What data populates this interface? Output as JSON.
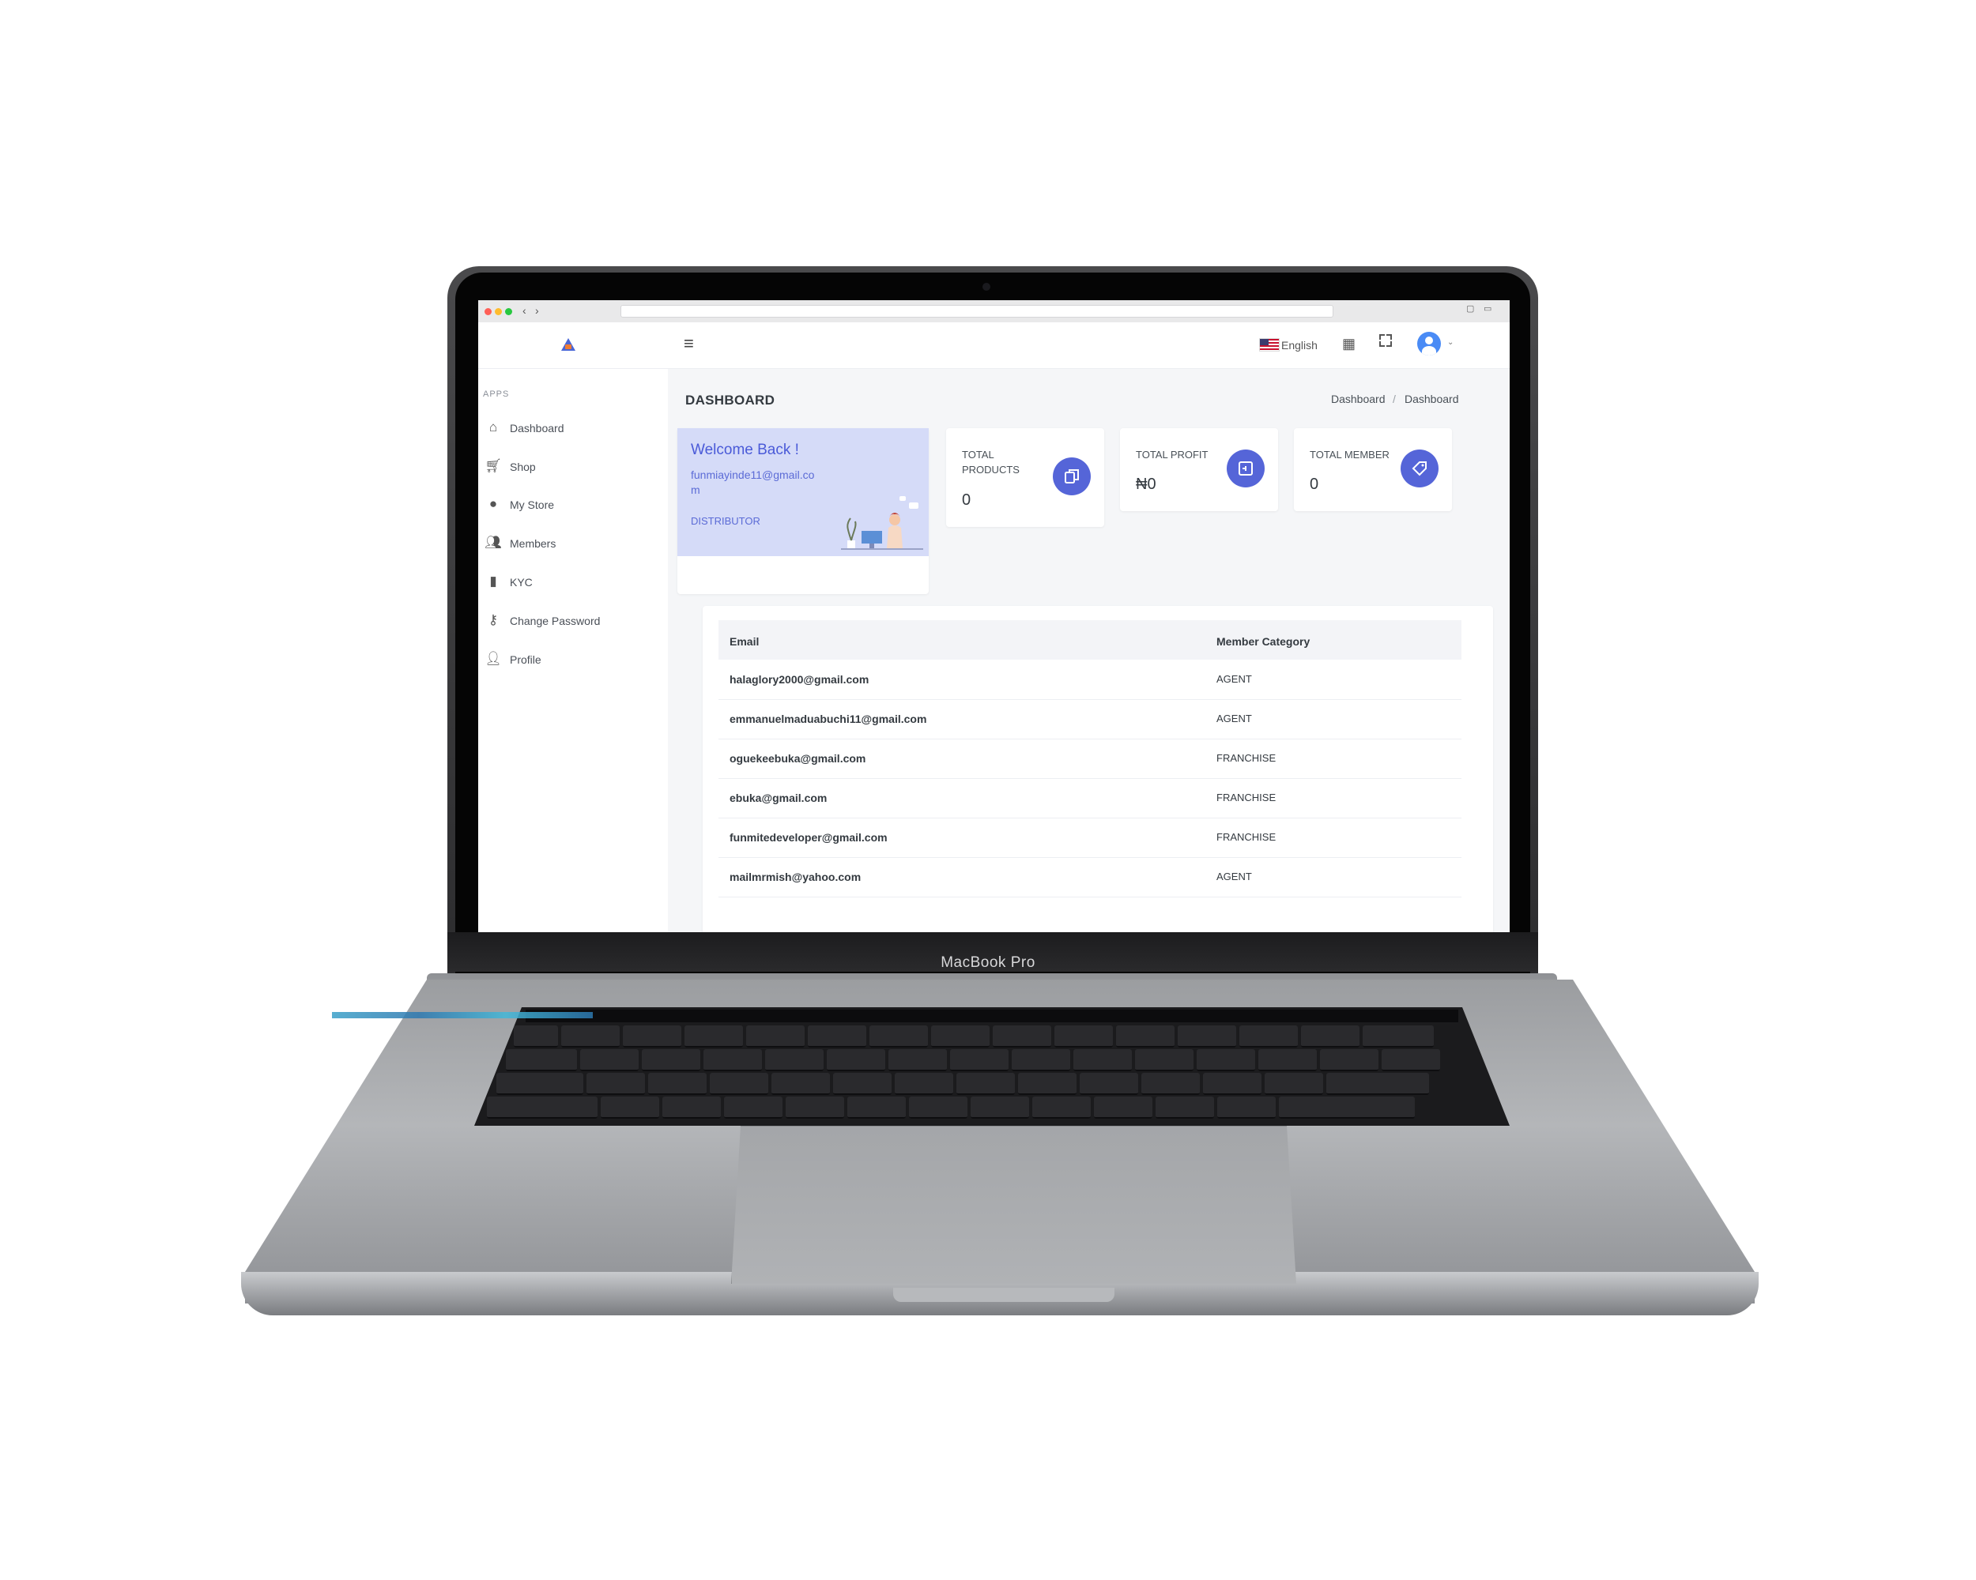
{
  "device": {
    "brand_text": "MacBook Pro"
  },
  "topbar": {
    "language": "English"
  },
  "sidebar": {
    "section_label": "APPS",
    "items": [
      {
        "label": "Dashboard",
        "icon": "home-icon"
      },
      {
        "label": "Shop",
        "icon": "cart-icon"
      },
      {
        "label": "My Store",
        "icon": "store-icon"
      },
      {
        "label": "Members",
        "icon": "users-icon"
      },
      {
        "label": "KYC",
        "icon": "document-icon"
      },
      {
        "label": "Change Password",
        "icon": "key-icon"
      },
      {
        "label": "Profile",
        "icon": "user-icon"
      }
    ]
  },
  "page": {
    "title": "DASHBOARD",
    "breadcrumb": [
      "Dashboard",
      "Dashboard"
    ]
  },
  "welcome": {
    "title": "Welcome Back !",
    "email": "funmiayinde11@gmail.com",
    "role": "DISTRIBUTOR"
  },
  "stats": [
    {
      "label": "TOTAL PRODUCTS",
      "value": "0",
      "icon": "copy-icon"
    },
    {
      "label": "TOTAL PROFIT",
      "value": "₦0",
      "icon": "archive-icon"
    },
    {
      "label": "TOTAL MEMBER",
      "value": "0",
      "icon": "tag-icon"
    }
  ],
  "members_table": {
    "columns": [
      "Email",
      "Member Category"
    ],
    "rows": [
      [
        "halaglory2000@gmail.com",
        "AGENT"
      ],
      [
        "emmanuelmaduabuchi11@gmail.com",
        "AGENT"
      ],
      [
        "oguekeebuka@gmail.com",
        "FRANCHISE"
      ],
      [
        "ebuka@gmail.com",
        "FRANCHISE"
      ],
      [
        "funmitedeveloper@gmail.com",
        "FRANCHISE"
      ],
      [
        "mailmrmish@yahoo.com",
        "AGENT"
      ]
    ]
  },
  "colors": {
    "accent": "#5565d8",
    "welcome_bg": "#d5dbf8",
    "page_bg": "#f5f6f8"
  }
}
